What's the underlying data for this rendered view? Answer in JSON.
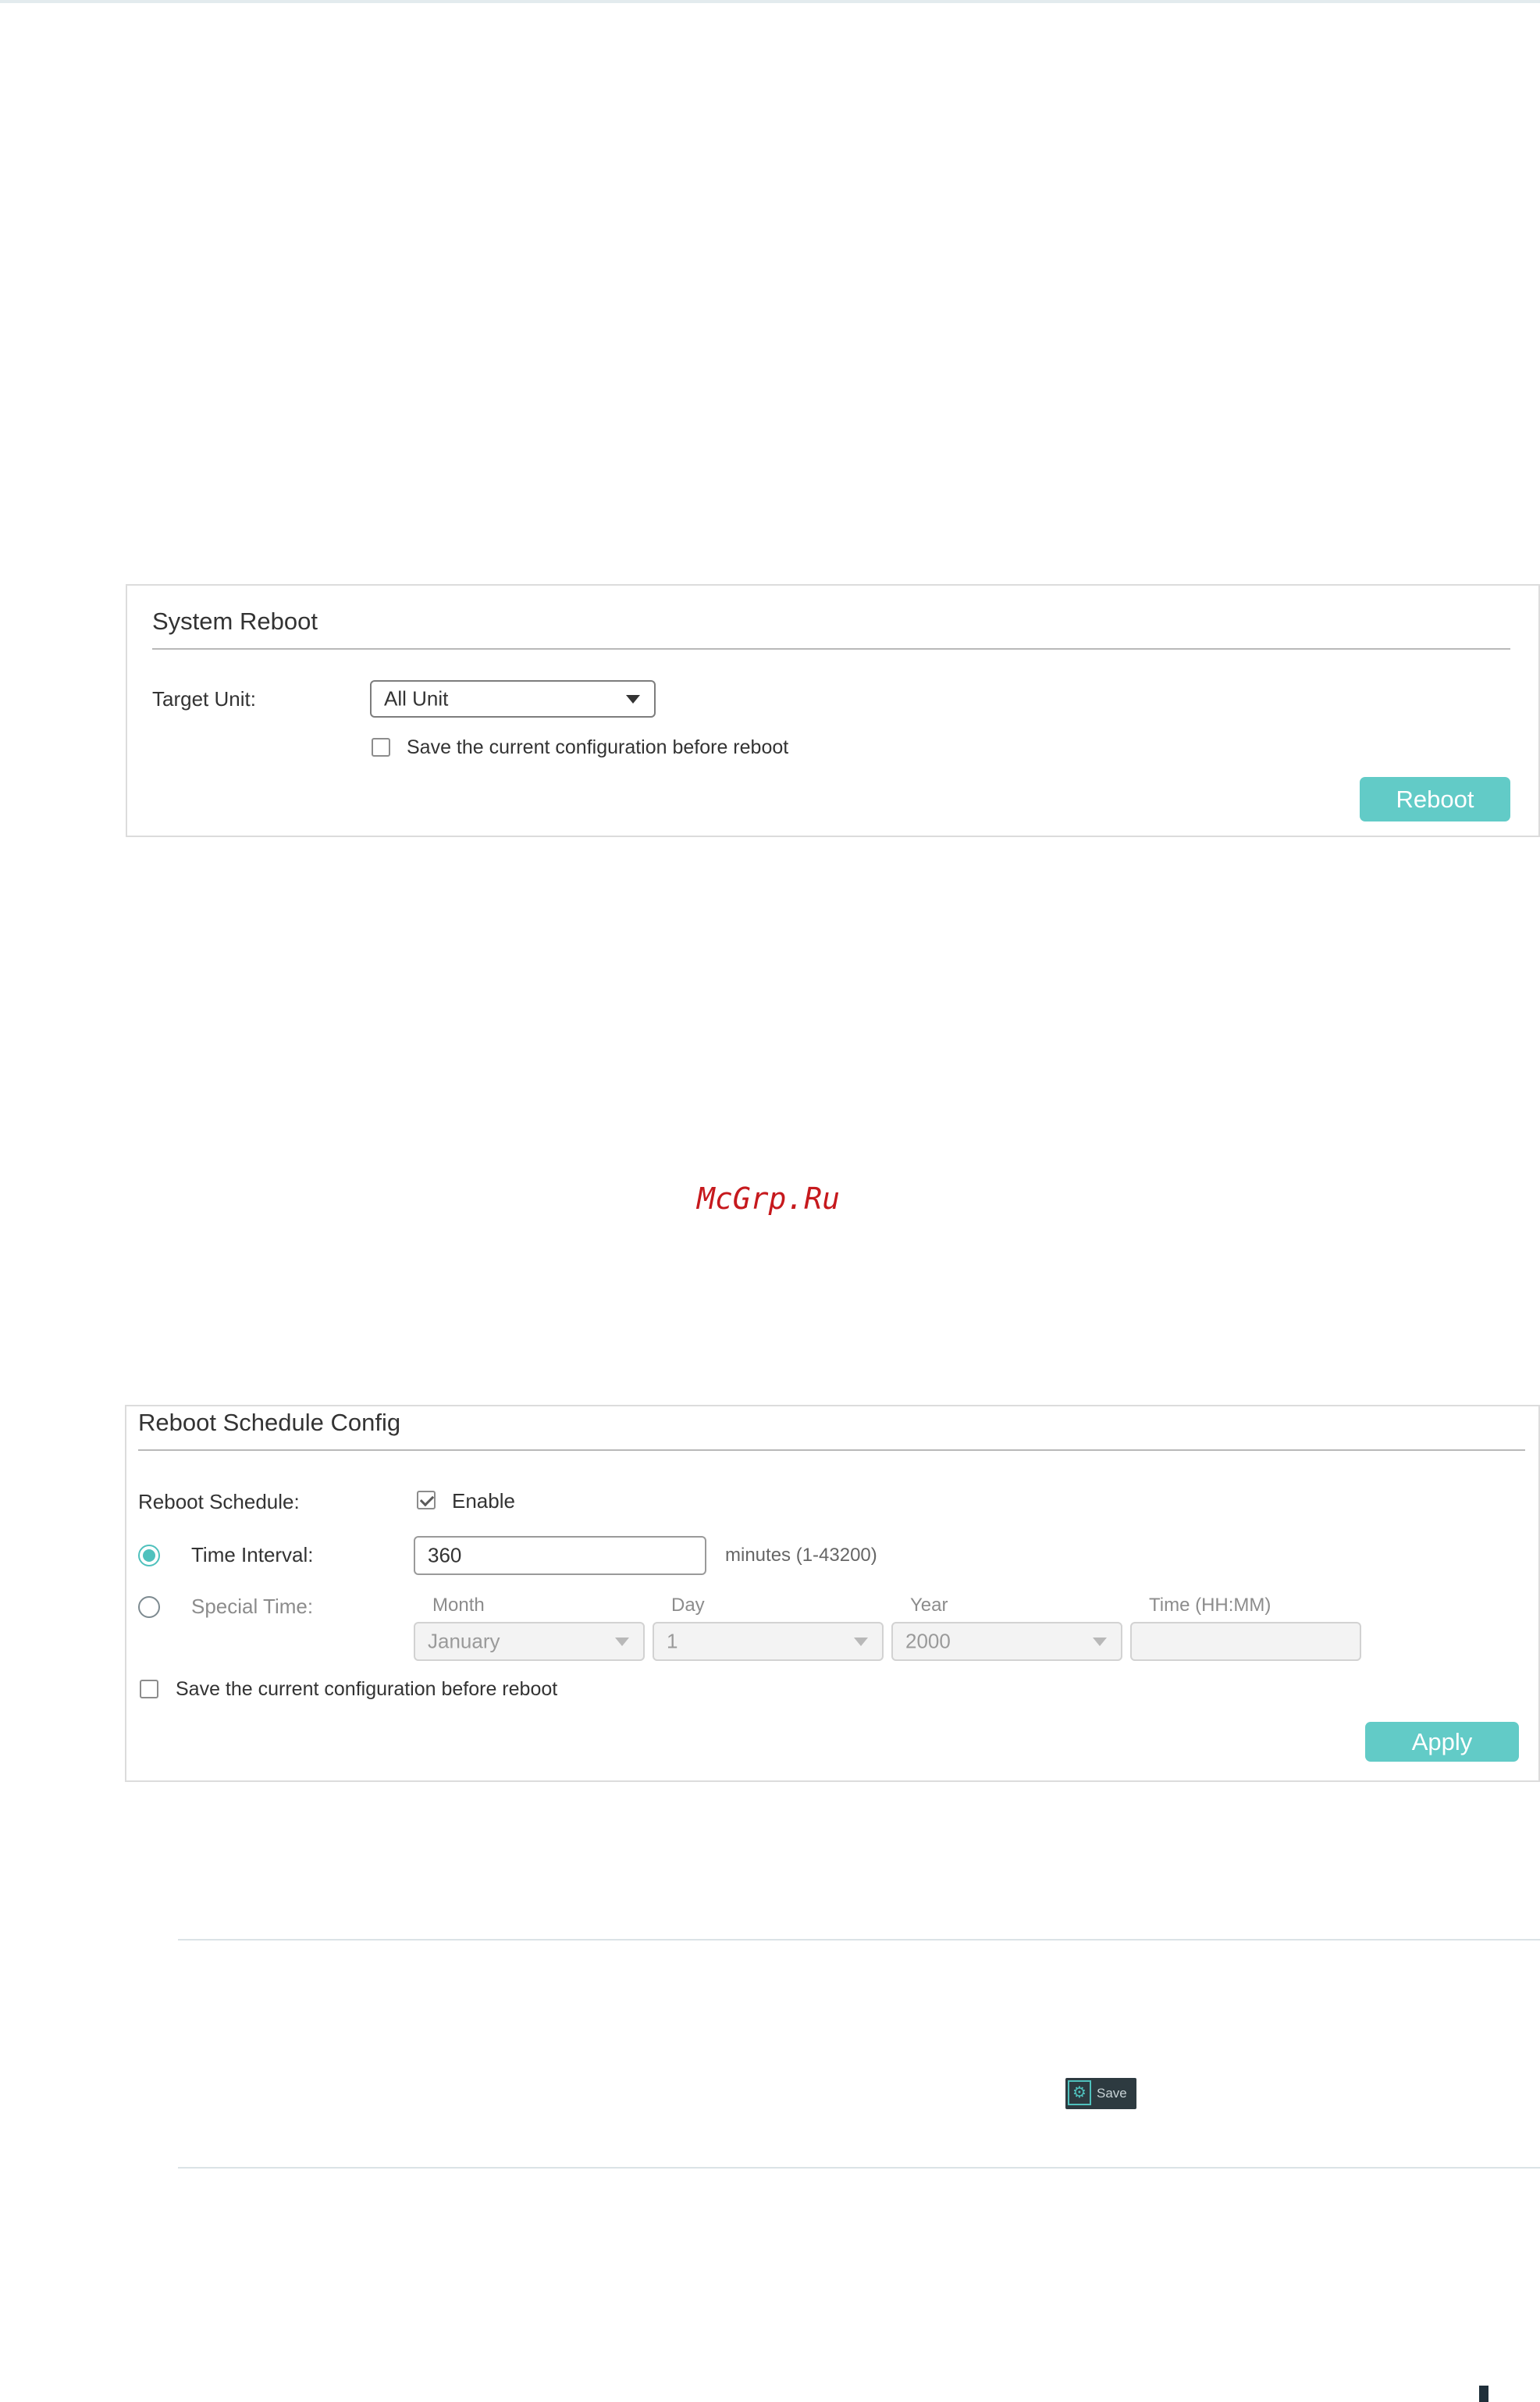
{
  "watermark": "McGrp.Ru",
  "system_reboot": {
    "title": "System Reboot",
    "target_unit_label": "Target Unit:",
    "target_unit_value": "All Unit",
    "save_config_label": "Save the current configuration before reboot",
    "save_config_checked": false,
    "reboot_button": "Reboot"
  },
  "reboot_schedule": {
    "title": "Reboot Schedule Config",
    "schedule_label": "Reboot Schedule:",
    "enable_label": "Enable",
    "enable_checked": true,
    "time_interval_label": "Time Interval:",
    "time_interval_selected": true,
    "time_interval_value": "360",
    "time_interval_hint": "minutes (1-43200)",
    "special_time_label": "Special Time:",
    "special_time_selected": false,
    "month_header": "Month",
    "day_header": "Day",
    "year_header": "Year",
    "time_header": "Time (HH:MM)",
    "month_value": "January",
    "day_value": "1",
    "year_value": "2000",
    "time_value": "",
    "save_config_label": "Save the current configuration before reboot",
    "save_config_checked": false,
    "apply_button": "Apply"
  },
  "note": {
    "save_button_label": "Save",
    "save_icon": "gear-icon"
  },
  "colors": {
    "accent": "#62cbc7",
    "watermark": "#c6191d"
  }
}
